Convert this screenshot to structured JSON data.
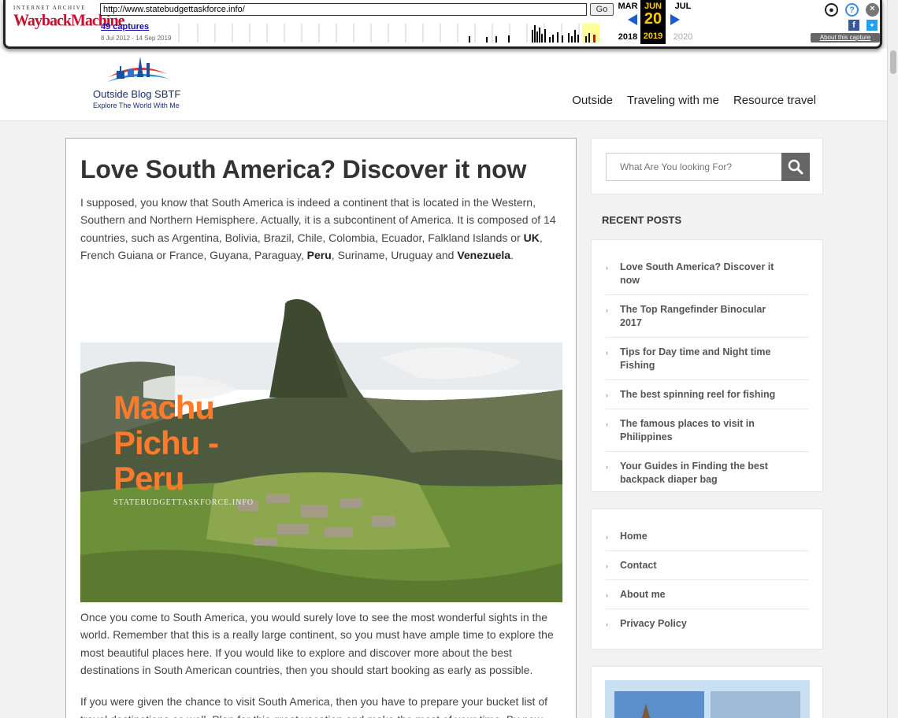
{
  "wayback": {
    "logo_top": "INTERNET ARCHIVE",
    "logo_main": "WaybackMachine",
    "url": "http://www.statebudgettaskforce.info/",
    "go_label": "Go",
    "captures": "49 captures",
    "range": "8 Jul 2012 - 14 Sep 2019",
    "months": [
      "MAR",
      "JUN",
      "JUL"
    ],
    "day": "20",
    "years": [
      "2018",
      "2019",
      "2020"
    ],
    "about": "About this capture",
    "accent": "#ffcc00"
  },
  "site": {
    "logo_title": "Outside Blog SBTF",
    "logo_tagline": "Explore The World With Me",
    "nav": [
      "Outside",
      "Traveling with me",
      "Resource travel"
    ]
  },
  "article": {
    "title": "Love South America? Discover it now",
    "p1_parts": [
      "I supposed, you know that South America is indeed a continent that is located in the Western, Southern and Northern Hemisphere. Actually, it is a subcontinent of America. It is composed of 14 countries, such as Argentina, Bolivia, Brazil, Chile, Colombia, Ecuador, Falkland Islands or ",
      "UK",
      ", French Guiana or France, Guyana, Paraguay, ",
      "Peru",
      ", Suriname, Uruguay and ",
      "Venezuela",
      "."
    ],
    "hero_title_lines": [
      "Machu",
      "Pichu -",
      "Peru"
    ],
    "hero_watermark": "STATEBUDGETTASKFORCE.INFO",
    "p2": "Once you come to South America, you would surely love to see the most wonderful sights in the world. Remember that this is a really large continent, so you must have ample time to explore the most beautiful places here. If you would like to explore and discover more about the best destinations in South American countries, then you should start booking as early as possible.",
    "p3": "If you were given the chance to visit South America, then you have to prepare your bucket list of travel destinations as well. Plan for this great vacation and make the most of your time. By now,"
  },
  "sidebar": {
    "search_placeholder": "What Are You looking For?",
    "recent_heading": "RECENT POSTS",
    "recent_posts": [
      "Love South America? Discover it now",
      "The Top Rangefinder Binocular 2017",
      "Tips for Day time and Night time Fishing",
      "The best spinning reel for fishing",
      "The famous places to visit in Philippines",
      "Your Guides in Finding the best backpack diaper bag"
    ],
    "pages": [
      "Home",
      "Contact",
      "About me",
      "Privacy Policy"
    ]
  }
}
